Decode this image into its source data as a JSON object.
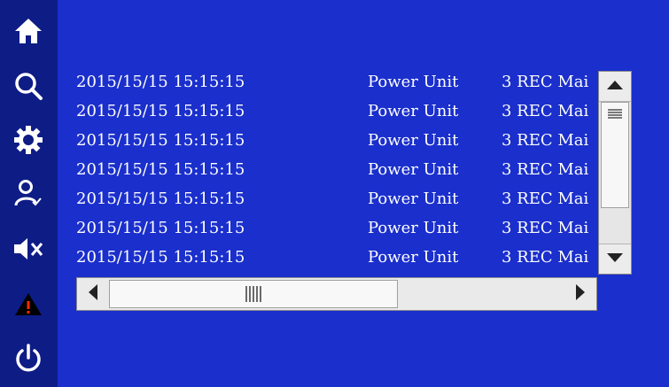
{
  "colors": {
    "background": "#1a2fcc",
    "sidebar": "#0e1c86",
    "text": "#ffffff",
    "alarm_accent": "#ff2a00"
  },
  "sidebar": {
    "items": [
      {
        "name": "home",
        "icon": "home-icon"
      },
      {
        "name": "search",
        "icon": "search-icon"
      },
      {
        "name": "settings",
        "icon": "gear-icon"
      },
      {
        "name": "user",
        "icon": "user-check-icon"
      },
      {
        "name": "mute",
        "icon": "speaker-mute-icon"
      },
      {
        "name": "alarm",
        "icon": "warning-icon"
      },
      {
        "name": "power",
        "icon": "power-icon"
      }
    ]
  },
  "log": {
    "rows": [
      {
        "timestamp": "2015/15/15 15:15:15",
        "source": "Power Unit",
        "message": "3 REC Mai"
      },
      {
        "timestamp": "2015/15/15 15:15:15",
        "source": "Power Unit",
        "message": "3 REC Mai"
      },
      {
        "timestamp": "2015/15/15 15:15:15",
        "source": "Power Unit",
        "message": "3 REC Mai"
      },
      {
        "timestamp": "2015/15/15 15:15:15",
        "source": "Power Unit",
        "message": "3 REC Mai"
      },
      {
        "timestamp": "2015/15/15 15:15:15",
        "source": "Power Unit",
        "message": "3 REC Mai"
      },
      {
        "timestamp": "2015/15/15 15:15:15",
        "source": "Power Unit",
        "message": "3 REC Mai"
      },
      {
        "timestamp": "2015/15/15 15:15:15",
        "source": "Power Unit",
        "message": "3 REC Mai"
      }
    ]
  }
}
